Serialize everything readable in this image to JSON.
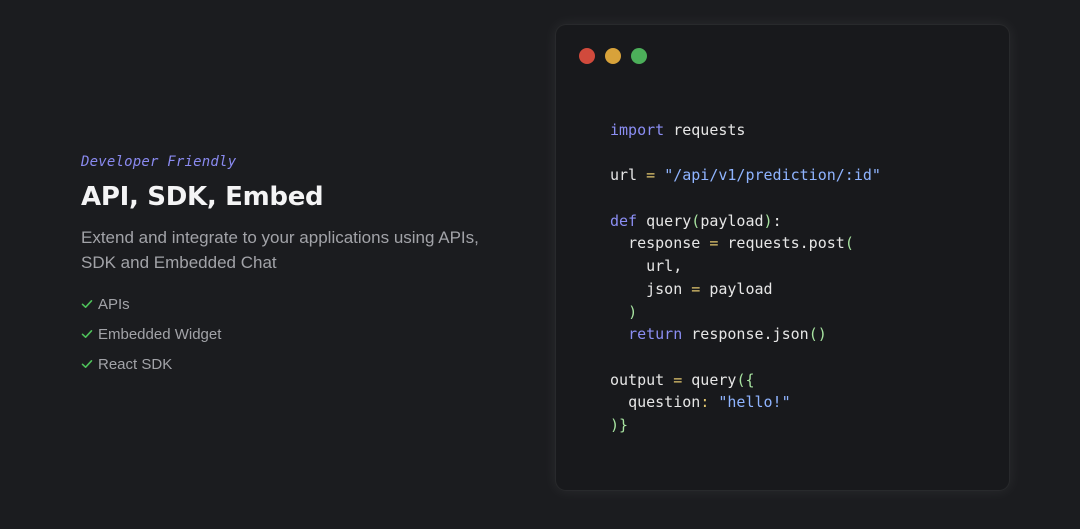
{
  "section": {
    "eyebrow": "Developer Friendly",
    "title": "API, SDK, Embed",
    "description": "Extend and integrate to your applications using APIs, SDK and Embedded Chat",
    "features": [
      {
        "label": "APIs",
        "icon": "check-icon"
      },
      {
        "label": "Embedded Widget",
        "icon": "check-icon"
      },
      {
        "label": "React SDK",
        "icon": "check-icon"
      }
    ]
  },
  "code_window": {
    "traffic_lights": [
      "#d14a3c",
      "#d8a23a",
      "#4caf5a"
    ],
    "lines": [
      {
        "indent": "",
        "parts": [
          {
            "t": "kw",
            "v": "import"
          },
          {
            "t": "id",
            "v": " requests"
          }
        ]
      },
      {
        "indent": "",
        "parts": []
      },
      {
        "indent": "",
        "parts": [
          {
            "t": "id",
            "v": "url "
          },
          {
            "t": "op",
            "v": "="
          },
          {
            "t": "id",
            "v": " "
          },
          {
            "t": "str",
            "v": "\"/api/v1/prediction/:id\""
          }
        ]
      },
      {
        "indent": "",
        "parts": []
      },
      {
        "indent": "",
        "parts": [
          {
            "t": "kw",
            "v": "def"
          },
          {
            "t": "id",
            "v": " query"
          },
          {
            "t": "punc",
            "v": "("
          },
          {
            "t": "id",
            "v": "payload"
          },
          {
            "t": "punc",
            "v": ")"
          },
          {
            "t": "id",
            "v": ":"
          }
        ]
      },
      {
        "indent": "  ",
        "parts": [
          {
            "t": "id",
            "v": "response "
          },
          {
            "t": "op",
            "v": "="
          },
          {
            "t": "id",
            "v": " requests.post"
          },
          {
            "t": "punc",
            "v": "("
          }
        ]
      },
      {
        "indent": "    ",
        "parts": [
          {
            "t": "id",
            "v": "url,"
          }
        ]
      },
      {
        "indent": "    ",
        "parts": [
          {
            "t": "id",
            "v": "json "
          },
          {
            "t": "op",
            "v": "="
          },
          {
            "t": "id",
            "v": " payload"
          }
        ]
      },
      {
        "indent": "  ",
        "parts": [
          {
            "t": "punc",
            "v": ")"
          }
        ]
      },
      {
        "indent": "  ",
        "parts": [
          {
            "t": "kw",
            "v": "return"
          },
          {
            "t": "id",
            "v": " response.json"
          },
          {
            "t": "punc",
            "v": "()"
          }
        ]
      },
      {
        "indent": "",
        "parts": []
      },
      {
        "indent": "",
        "parts": [
          {
            "t": "id",
            "v": "output "
          },
          {
            "t": "op",
            "v": "="
          },
          {
            "t": "id",
            "v": " query"
          },
          {
            "t": "punc",
            "v": "({"
          }
        ]
      },
      {
        "indent": "  ",
        "parts": [
          {
            "t": "id",
            "v": "question"
          },
          {
            "t": "op",
            "v": ":"
          },
          {
            "t": "id",
            "v": " "
          },
          {
            "t": "str",
            "v": "\"hello!\""
          }
        ]
      },
      {
        "indent": "",
        "parts": [
          {
            "t": "punc",
            "v": ")}"
          }
        ]
      }
    ]
  }
}
